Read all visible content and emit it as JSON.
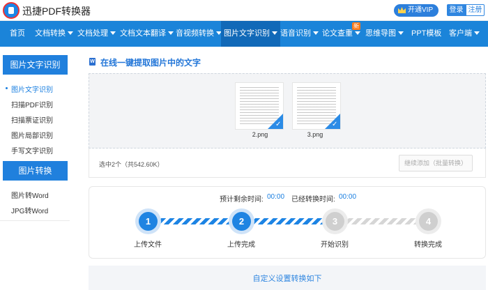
{
  "header": {
    "app_title": "迅捷PDF转换器",
    "vip_label": "开通VIP",
    "login_label": "登录",
    "register_label": "注册"
  },
  "nav": {
    "items": [
      {
        "label": "首页",
        "caret": false
      },
      {
        "label": "文档转换",
        "caret": true
      },
      {
        "label": "文档处理",
        "caret": true
      },
      {
        "label": "文档文本翻译",
        "caret": true
      },
      {
        "label": "音视频转换",
        "caret": true
      },
      {
        "label": "图片文字识别",
        "caret": true,
        "active": true
      },
      {
        "label": "语音识别",
        "caret": true
      },
      {
        "label": "论文查重",
        "caret": true
      },
      {
        "label": "思维导图",
        "caret": true
      },
      {
        "label": "PPT模板",
        "caret": false
      },
      {
        "label": "客户端",
        "caret": true
      }
    ],
    "new_badge": "新"
  },
  "sidebar": {
    "section1_title": "图片文字识别",
    "section1_items": [
      "图片文字识别",
      "扫描PDF识别",
      "扫描票证识别",
      "图片局部识别",
      "手写文字识别"
    ],
    "section2_title": "图片转换",
    "section2_items": [
      "图片转Word",
      "JPG转Word"
    ]
  },
  "main": {
    "title": "在线一键提取图片中的文字",
    "word_icon_letter": "W",
    "files": [
      {
        "name": "2.png",
        "checked": true
      },
      {
        "name": "3.png",
        "checked": true
      }
    ],
    "selection_summary": "选中2个（共542.60K）",
    "add_button": "继续添加（批量转换）",
    "time_remaining_label": "预计剩余时间:",
    "time_remaining_value": "00:00",
    "time_elapsed_label": "已经转换时间:",
    "time_elapsed_value": "00:00",
    "steps": [
      {
        "num": "1",
        "label": "上传文件",
        "done": true
      },
      {
        "num": "2",
        "label": "上传完成",
        "done": true
      },
      {
        "num": "3",
        "label": "开始识别",
        "done": false
      },
      {
        "num": "4",
        "label": "转换完成",
        "done": false
      }
    ],
    "custom_settings_label": "自定义设置转换如下"
  },
  "colors": {
    "brand_blue": "#1b84d9",
    "accent_blue": "#1f84e2",
    "badge_orange": "#ff7a1a"
  }
}
